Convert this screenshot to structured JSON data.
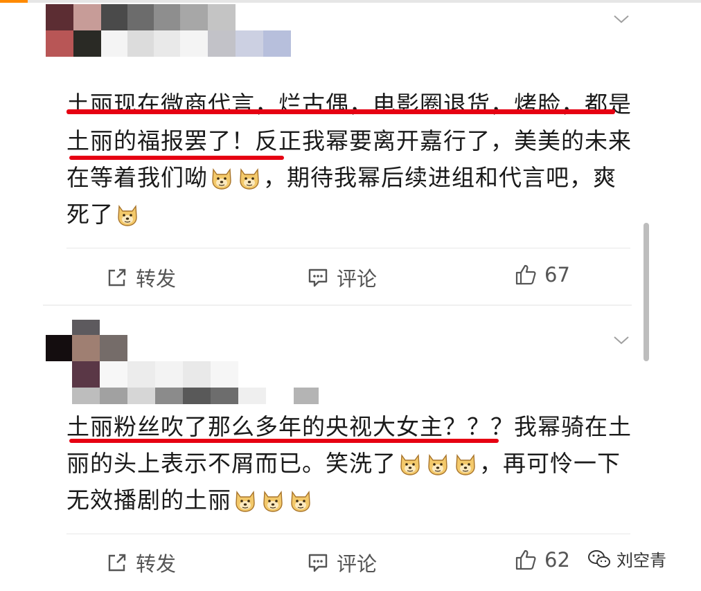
{
  "posts": [
    {
      "text_segments": [
        "土丽现在微商代言，烂古偶，电影圈退货，烤脸，都是土丽的福报罢了！反正我幂要离开嘉行了，美美的未来在等着我们呦",
        "，期待我幂后续进组和代言吧，爽死了"
      ],
      "actions": {
        "repost": "转发",
        "comment": "评论",
        "likes": "67"
      }
    },
    {
      "text_segments": [
        "土丽粉丝吹了那么多年的央视大女主？？？我幂骑在土丽的头上表示不屑而已。笑洗了",
        "，再可怜一下无效播剧的土丽"
      ],
      "actions": {
        "repost": "转发",
        "comment": "评论",
        "likes": "62"
      }
    }
  ],
  "icons": {
    "repost": "share-square-icon",
    "comment": "comment-bubble-icon",
    "like": "thumbs-up-icon",
    "emoji": "doge-emoji-icon",
    "more": "chevron-down-icon",
    "watermark": "wechat-icon"
  },
  "watermark": {
    "text": "刘空青"
  },
  "colors": {
    "underline": "#e60012",
    "text": "#1a1a1a",
    "action": "#555555"
  }
}
